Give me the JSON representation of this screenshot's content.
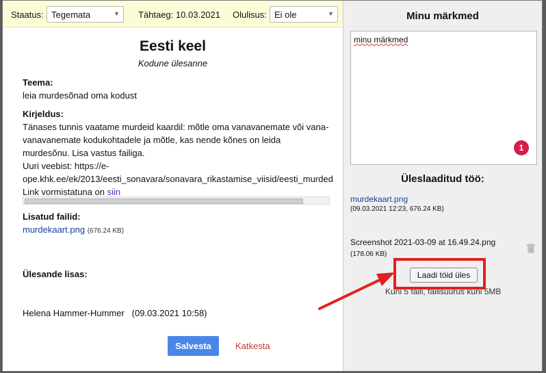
{
  "status_bar": {
    "status_label": "Staatus:",
    "status_value": "Tegemata",
    "deadline": "Tähtaeg: 10.03.2021",
    "priority_label": "Olulisus:",
    "priority_value": "Ei ole"
  },
  "task": {
    "title": "Eesti keel",
    "subtitle": "Kodune ülesanne",
    "topic_heading": "Teema:",
    "topic": "leia murdesõnad oma kodust",
    "desc_heading": "Kirjeldus:",
    "desc_lines": [
      "Tänases tunnis vaatame murdeid kaardil: mõtle oma vanavanemate või vana-",
      "vanavanemate kodukohtadele ja mõtle, kas nende kõnes on leida",
      "murdesõnu. Lisa vastus failiga.",
      "Uuri veebist: https://e-",
      "ope.khk.ee/ek/2013/eesti_sonavara/sonavara_rikastamise_viisid/eesti_murded"
    ],
    "link_prefix": "Link vormistatuna on ",
    "link_text": "siin",
    "files_heading": "Lisatud failid:",
    "file_name": "murdekaart.png",
    "file_size": "(676.24 KB)",
    "added_heading": "Ülesande lisas:",
    "added_by": "Helena Hammer-Hummer   (09.03.2021 10:58)"
  },
  "actions": {
    "save": "Salvesta",
    "cancel": "Katkesta"
  },
  "notes_panel": {
    "title": "Minu märkmed",
    "notes_text": "minu märkmed",
    "badge": "1",
    "uploaded_title": "Üleslaaditud töö:",
    "uploaded_file": "murdekaart.png",
    "uploaded_meta": "(09.03.2021 12:23, 676.24 KB)",
    "screenshot_file": "Screenshot 2021-03-09 at 16.49.24.png",
    "screenshot_size": "(178.06 KB)",
    "upload_button": "Laadi töid üles",
    "upload_hint": "Kuni 5 faili, failisuurus kuni 5MB"
  },
  "colors": {
    "accent": "#4a86e8",
    "highlight": "#e02020",
    "badge": "#d81b47"
  }
}
